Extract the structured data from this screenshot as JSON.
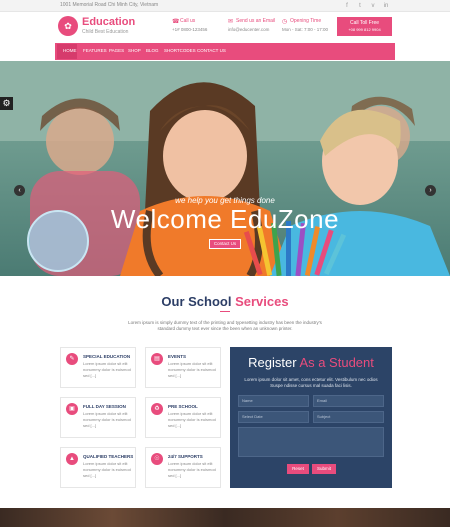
{
  "topbar": {
    "address": "1001 Memorial Road Chi Minh City, Vietnam",
    "social": [
      {
        "icon": "facebook-icon",
        "glyph": "f"
      },
      {
        "icon": "twitter-icon",
        "glyph": "t"
      },
      {
        "icon": "vimeo-icon",
        "glyph": "v"
      },
      {
        "icon": "linkedin-icon",
        "glyph": "in"
      }
    ]
  },
  "header": {
    "logo_title": "Education",
    "logo_subtitle": "Child Best Education",
    "call_label": "Call us",
    "call_value": "+1# 0800-123456",
    "email_label": "Send us an Email",
    "email_value": "info@educenter.com",
    "hours_label": "Opening Time",
    "hours_value": "Mon - Sat: 7:00 - 17:00",
    "toll_label": "Call Toll Free",
    "toll_value": "+08 999 812 9904"
  },
  "nav": {
    "items": [
      "HOME",
      "FEATURES",
      "PAGES",
      "SHOP",
      "BLOG",
      "SHORTCODES",
      "CONTACT US"
    ]
  },
  "hero": {
    "tagline": "we help you get things done",
    "title": "Welcome EduZone",
    "button": "Contact Us"
  },
  "services": {
    "title_main": "Our School",
    "title_accent": "Services",
    "description": "Lorem ipsum is simply dummy text of the printing and typesetting industry has been the industry's standard dummy text ever since the been when an unknown printer.",
    "items": [
      {
        "title": "SPECIAL EDUCATION",
        "desc": "Lorem ipsum dolor sit elit nonummy dolor is euismod sed [...]",
        "icon": "pencil-icon"
      },
      {
        "title": "EVENTS",
        "desc": "Lorem ipsum dolor sit elit nonummy dolor is euismod sed [...]",
        "icon": "calendar-icon"
      },
      {
        "title": "FULL DAY SESSION",
        "desc": "Lorem ipsum dolor sit elit nonummy dolor is euismod sed [...]",
        "icon": "book-icon"
      },
      {
        "title": "PRE SCHOOL",
        "desc": "Lorem ipsum dolor sit elit nonummy dolor is euismod sed [...]",
        "icon": "school-icon"
      },
      {
        "title": "QUALIFIED TEACHERS",
        "desc": "Lorem ipsum dolor sit elit nonummy dolor is euismod sed [...]",
        "icon": "teacher-icon"
      },
      {
        "title": "24/7 SUPPORTS",
        "desc": "Lorem ipsum dolor sit elit nonummy dolor is euismod sed [...]",
        "icon": "support-icon"
      }
    ]
  },
  "register": {
    "title_main": "Register",
    "title_accent": "As a Student",
    "description": "Lorem ipsum dolor sit amet, cons ectetur elit. Vestibulum nec odios Suspe ndisse cursus mal suada faci lisis.",
    "name_placeholder": "Name",
    "email_placeholder": "Email",
    "date_placeholder": "Select Date",
    "subject_placeholder": "Subject",
    "reset_label": "Reset",
    "submit_label": "Submit"
  },
  "colors": {
    "accent": "#e84c7d",
    "navy": "#2c4467"
  }
}
